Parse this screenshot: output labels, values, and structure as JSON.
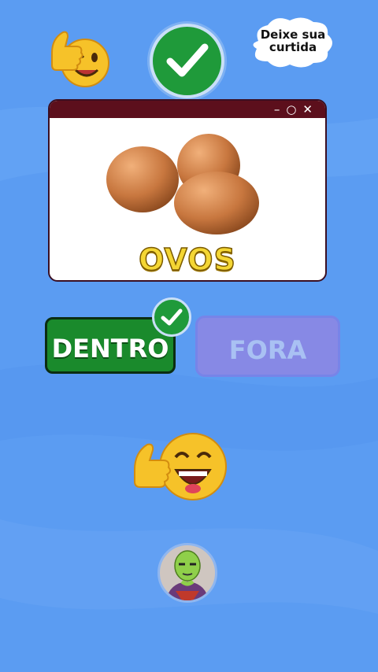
{
  "bubble": {
    "line1": "Deixe sua",
    "line2": "curtida"
  },
  "card": {
    "word": "OVOS",
    "controls": [
      "–",
      "○",
      "✕"
    ]
  },
  "answers": {
    "inside_label": "DENTRO",
    "outside_label": "FORA",
    "selected": "DENTRO"
  },
  "icons": {
    "top_left": "wink-thumbs-up-emoji",
    "top_center": "green-check-icon",
    "center": "laughing-thumbs-up-emoji",
    "bottom": "avatar-green-character"
  },
  "colors": {
    "background": "#5b9cf2",
    "correct_green": "#1a8a2c",
    "word_yellow": "#f4d634",
    "titlebar": "#5c0f1c"
  }
}
